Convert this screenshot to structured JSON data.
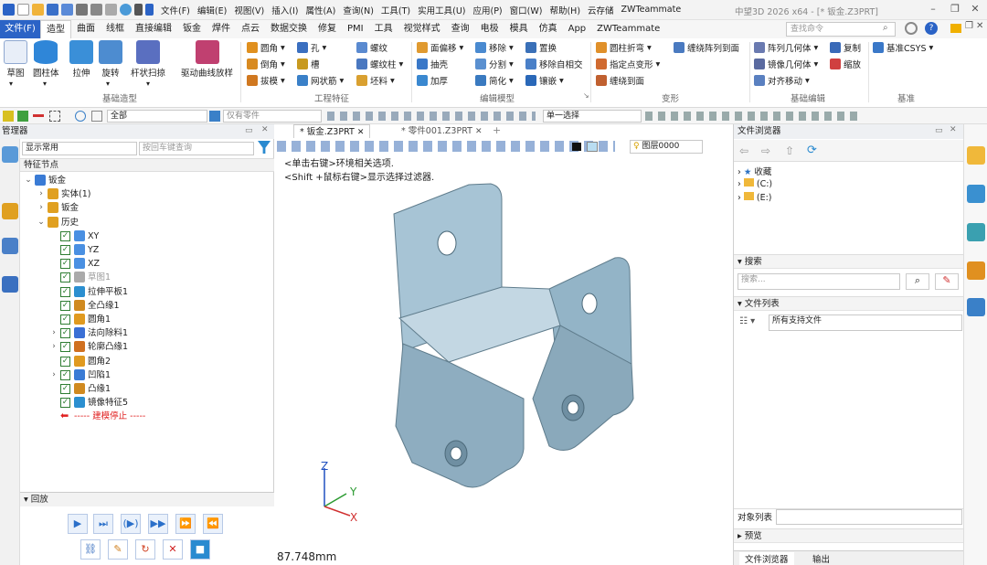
{
  "menubar": {
    "items": [
      "文件(F)",
      "编辑(E)",
      "视图(V)",
      "插入(I)",
      "属性(A)",
      "查询(N)",
      "工具(T)",
      "实用工具(U)",
      "应用(P)",
      "窗口(W)",
      "帮助(H)",
      "云存储",
      "ZWTeammate"
    ],
    "window_title": "中望3D 2026 x64 - [* 钣金.Z3PRT]"
  },
  "ribbon_tabs": [
    "文件(F)",
    "造型",
    "曲面",
    "线框",
    "直接编辑",
    "钣金",
    "焊件",
    "点云",
    "数据交换",
    "修复",
    "PMI",
    "工具",
    "视觉样式",
    "查询",
    "电极",
    "模具",
    "仿真",
    "App",
    "ZWTeammate"
  ],
  "active_tab": "造型",
  "search_placeholder": "查找命令",
  "ribbon": {
    "basic": {
      "label": "基础造型",
      "buttons": [
        "草图",
        "圆柱体",
        "拉伸",
        "旋转",
        "杆状扫掠",
        "驱动曲线放样"
      ]
    },
    "eng": {
      "label": "工程特征",
      "items": [
        "圆角",
        "倒角",
        "拔模",
        "孔",
        "槽",
        "网状筋",
        "螺纹",
        "螺纹柱",
        "坯料"
      ]
    },
    "edit": {
      "label": "编辑模型",
      "items": [
        "面偏移",
        "抽壳",
        "加厚",
        "移除",
        "分割",
        "简化",
        "置换",
        "移除自相交",
        "镶嵌"
      ]
    },
    "deform": {
      "label": "变形",
      "items": [
        "圆柱折弯",
        "指定点变形",
        "缠绕到面",
        "缠绕阵列到面"
      ]
    },
    "baseedit": {
      "label": "基础编辑",
      "items": [
        "阵列几何体",
        "镜像几何体",
        "对齐移动",
        "复制",
        "缩放"
      ]
    },
    "datum": {
      "label": "基准",
      "items": [
        "基准CSYS"
      ]
    }
  },
  "toolbar": {
    "filter": "全部",
    "part_select": "仅有零件",
    "select_mode": "单一选择"
  },
  "left_panel": {
    "title": "管理器",
    "display_select": "显示常用",
    "search_placeholder": "按回车键查询",
    "tree_header": "特征节点",
    "tree": [
      {
        "label": "钣金",
        "level": 0,
        "chev": "⌄",
        "check": false,
        "color": "#3a7bd5"
      },
      {
        "label": "实体(1)",
        "level": 1,
        "chev": "›",
        "check": false,
        "color": "#e0a020"
      },
      {
        "label": "钣金",
        "level": 1,
        "chev": "›",
        "check": false,
        "color": "#e0a020"
      },
      {
        "label": "历史",
        "level": 1,
        "chev": "⌄",
        "check": false,
        "color": "#e0a020"
      },
      {
        "label": "XY",
        "level": 2,
        "chev": "",
        "check": true,
        "color": "#4a90e2"
      },
      {
        "label": "YZ",
        "level": 2,
        "chev": "",
        "check": true,
        "color": "#4a90e2"
      },
      {
        "label": "XZ",
        "level": 2,
        "chev": "",
        "check": true,
        "color": "#4a90e2"
      },
      {
        "label": "草图1",
        "level": 2,
        "chev": "",
        "check": true,
        "color": "#aaaaaa",
        "dim": true
      },
      {
        "label": "拉伸平板1",
        "level": 2,
        "chev": "",
        "check": true,
        "color": "#2b8fd0"
      },
      {
        "label": "全凸缘1",
        "level": 2,
        "chev": "",
        "check": true,
        "color": "#d08a20"
      },
      {
        "label": "圆角1",
        "level": 2,
        "chev": "",
        "check": true,
        "color": "#e09a20"
      },
      {
        "label": "法向除料1",
        "level": 2,
        "chev": "›",
        "check": true,
        "color": "#3a6fd5"
      },
      {
        "label": "轮廓凸缘1",
        "level": 2,
        "chev": "›",
        "check": true,
        "color": "#d07020"
      },
      {
        "label": "圆角2",
        "level": 2,
        "chev": "",
        "check": true,
        "color": "#e09a20"
      },
      {
        "label": "凹陷1",
        "level": 2,
        "chev": "›",
        "check": true,
        "color": "#3a7bd5"
      },
      {
        "label": "凸缘1",
        "level": 2,
        "chev": "",
        "check": true,
        "color": "#d08a20"
      },
      {
        "label": "镜像特征5",
        "level": 2,
        "chev": "",
        "check": true,
        "color": "#2b8fd0"
      },
      {
        "label": "----- 建模停止 -----",
        "level": 2,
        "chev": "",
        "check": false,
        "color": "#e02020",
        "stop": true
      }
    ],
    "playback_label": "回放"
  },
  "viewport": {
    "tabs": [
      "* 钣金.Z3PRT",
      "* 零件001.Z3PRT"
    ],
    "layer": "图层0000",
    "hint1": "<单击右键>环境相关选项.",
    "hint2": "<Shift +鼠标右键>显示选择过滤器.",
    "measure": "87.748mm",
    "axes": {
      "x": "X",
      "y": "Y",
      "z": "Z"
    }
  },
  "right_panel": {
    "title": "文件浏览器",
    "folders": [
      "收藏",
      "(C:)",
      "(E:)"
    ],
    "search_label": "搜索",
    "search_placeholder": "搜索...",
    "file_list_label": "文件列表",
    "file_filter": "所有支持文件",
    "object_list_label": "对象列表",
    "preview_label": "预览",
    "bottom_tabs": [
      "文件浏览器",
      "输出"
    ]
  }
}
